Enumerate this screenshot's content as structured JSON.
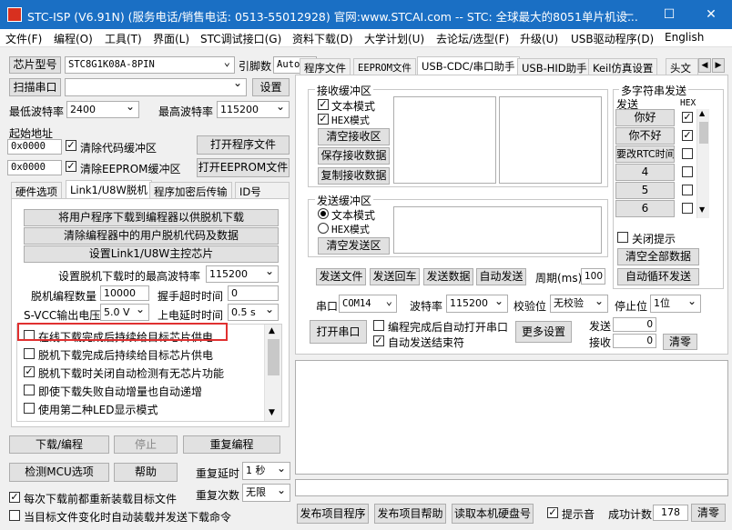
{
  "window": {
    "title": "STC-ISP (V6.91N) (服务电话/销售电话: 0513-55012928) 官网:www.STCAI.com  -- STC: 全球最大的8051单片机设...",
    "minimize": "—",
    "maximize": "☐",
    "close": "✕"
  },
  "menu": [
    "文件(F)",
    "编程(O)",
    "工具(T)",
    "界面(L)",
    "STC调试接口(G)",
    "资料下载(D)",
    "大学计划(U)",
    "去论坛/选型(F)",
    "升级(U)",
    "USB驱动程序(D)",
    "English"
  ],
  "left": {
    "chip_type_label": "芯片型号",
    "chip_type_value": "STC8G1K08A-8PIN",
    "pin_label": "引脚数",
    "pin_value": "Auto",
    "scan_port": "扫描串口",
    "port_value": "",
    "settings": "设置",
    "min_baud_label": "最低波特率",
    "min_baud_value": "2400",
    "max_baud_label": "最高波特率",
    "max_baud_value": "115200",
    "start_addr_label": "起始地址",
    "addr1": "0x0000",
    "clear_code_label": "清除代码缓冲区",
    "open_program": "打开程序文件",
    "addr2": "0x0000",
    "clear_eeprom_label": "清除EEPROM缓冲区",
    "open_eeprom": "打开EEPROM文件",
    "tabs": [
      "硬件选项",
      "Link1/U8W脱机",
      "程序加密后传输",
      "ID号"
    ],
    "offline": {
      "btn1": "将用户程序下载到编程器以供脱机下载",
      "btn2": "清除编程器中的用户脱机代码及数据",
      "btn3": "设置Link1/U8W主控芯片",
      "max_baud_label": "设置脱机下载时的最高波特率",
      "max_baud_value": "115200",
      "count_label": "脱机编程数量",
      "count_value": "10000",
      "timeout_label": "握手超时时间",
      "timeout_value": "0",
      "svcc_label": "S-VCC输出电压",
      "svcc_value": "5.0 V",
      "delay_label": "上电延时时间",
      "delay_value": "0.5 s",
      "options": [
        {
          "label": "在线下载完成后持续给目标芯片供电",
          "checked": false
        },
        {
          "label": "脱机下载完成后持续给目标芯片供电",
          "checked": false
        },
        {
          "label": "脱机下载时关闭自动检测有无芯片功能",
          "checked": true
        },
        {
          "label": "即使下载失败自动增量也自动递增",
          "checked": false
        },
        {
          "label": "使用第二种LED显示模式",
          "checked": false
        }
      ]
    },
    "download": "下载/编程",
    "stop": "停止",
    "reprogram": "重复编程",
    "detect": "检测MCU选项",
    "help": "帮助",
    "repeat_delay_label": "重复延时",
    "repeat_delay_value": "1 秒",
    "repeat_count_label": "重复次数",
    "repeat_count_value": "无限",
    "reload_each": "每次下载前都重新装载目标文件",
    "auto_reload": "当目标文件变化时自动装载并发送下载命令"
  },
  "right": {
    "tabs": [
      "程序文件",
      "EEPROM文件",
      "USB-CDC/串口助手",
      "USB-HID助手",
      "Keil仿真设置",
      "头文"
    ],
    "recv_title": "接收缓冲区",
    "text_mode": "文本模式",
    "hex_mode": "HEX模式",
    "clear_recv": "清空接收区",
    "save_recv": "保存接收数据",
    "copy_recv": "复制接收数据",
    "send_title": "发送缓冲区",
    "send_text_mode": "文本模式",
    "send_hex_mode": "HEX模式",
    "clear_send": "清空发送区",
    "multi_title": "多字符串发送",
    "multi_send": "发送",
    "multi_hex": "HEX",
    "multi_items": [
      {
        "label": "你好",
        "checked": true
      },
      {
        "label": "你不好",
        "checked": true
      },
      {
        "label": "要改RTC时间",
        "checked": false
      },
      {
        "label": "4",
        "checked": false
      },
      {
        "label": "5",
        "checked": false
      },
      {
        "label": "6",
        "checked": false
      }
    ],
    "close_tip": "关闭提示",
    "clear_all": "清空全部数据",
    "auto_loop": "自动循环发送",
    "send_file": "发送文件",
    "send_return": "发送回车",
    "send_data": "发送数据",
    "auto_send": "自动发送",
    "period_label": "周期(ms)",
    "period_value": "100",
    "port_label": "串口",
    "port_value": "COM14",
    "baud_label": "波特率",
    "baud_value": "115200",
    "parity_label": "校验位",
    "parity_value": "无校验",
    "stop_label": "停止位",
    "stop_value": "1位",
    "open_port": "打开串口",
    "auto_open": "编程完成后自动打开串口",
    "auto_end": "自动发送结束符",
    "more": "更多设置",
    "send_count_label": "发送",
    "send_count": "0",
    "recv_count_label": "接收",
    "recv_count": "0",
    "clear_count": "清零"
  },
  "bottom": {
    "publish": "发布项目程序",
    "publish_help": "发布项目帮助",
    "read_disk": "读取本机硬盘号",
    "sound": "提示音",
    "success_label": "成功计数",
    "success_value": "178",
    "clear": "清零"
  }
}
